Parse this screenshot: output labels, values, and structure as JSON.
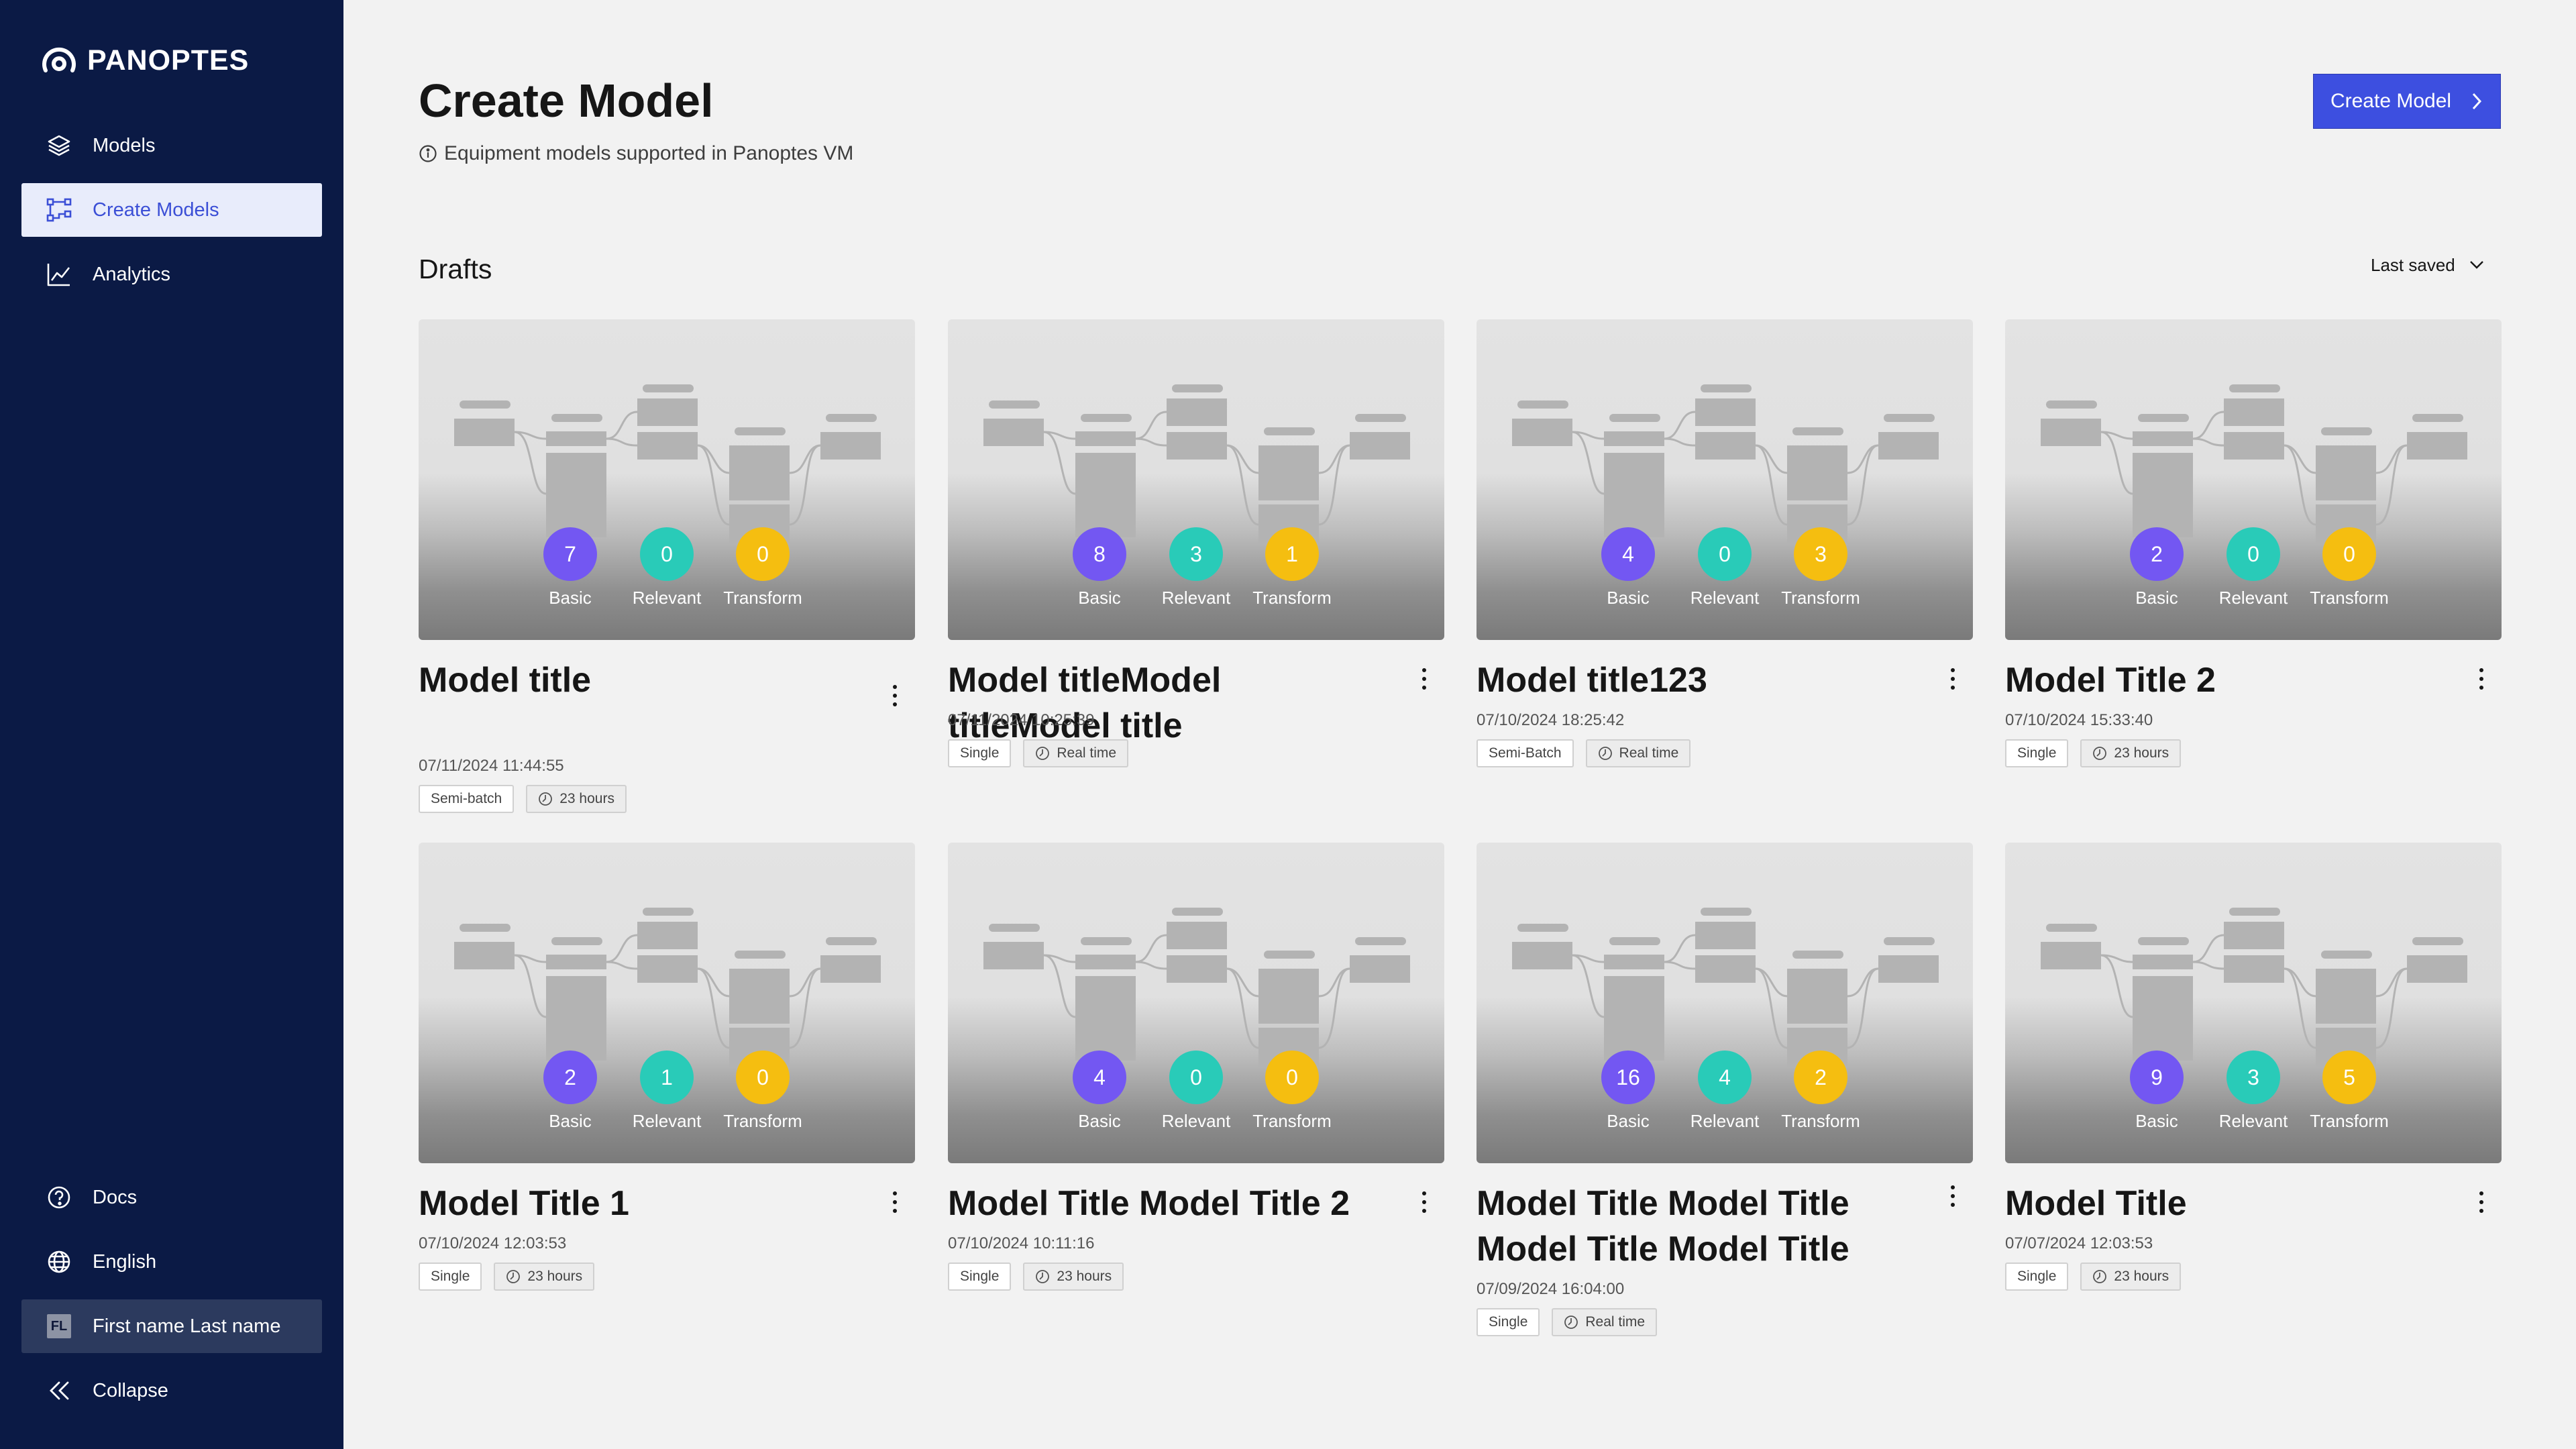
{
  "sidebar": {
    "brand": "PANOPTES",
    "nav": [
      {
        "label": "Models",
        "icon": "layers-icon"
      },
      {
        "label": "Create Models",
        "icon": "flow-icon",
        "active": true
      },
      {
        "label": "Analytics",
        "icon": "chart-line-icon"
      }
    ],
    "bottom": [
      {
        "label": "Docs",
        "icon": "help-circle-icon"
      },
      {
        "label": "English",
        "icon": "globe-icon"
      },
      {
        "label": "First name Last name",
        "initials": "FL"
      },
      {
        "label": "Collapse",
        "icon": "double-chevron-left-icon"
      }
    ]
  },
  "header": {
    "title": "Create Model",
    "subtitle": "Equipment models supported in Panoptes VM",
    "create_button": "Create Model"
  },
  "drafts": {
    "heading": "Drafts",
    "sort_label": "Last saved",
    "badge_labels": {
      "basic": "Basic",
      "relevant": "Relevant",
      "transform": "Transform"
    },
    "cards": [
      {
        "title": "Model title",
        "date": "07/11/2024 11:44:55",
        "type": "Semi-batch",
        "duration": "23 hours",
        "basic": 7,
        "relevant": 0,
        "transform": 0
      },
      {
        "title": "Model titleModel titleModel title",
        "date": "07/11/2024 10:25:39",
        "type": "Single",
        "duration": "Real time",
        "basic": 8,
        "relevant": 3,
        "transform": 1
      },
      {
        "title": "Model title123",
        "date": "07/10/2024 18:25:42",
        "type": "Semi-Batch",
        "duration": "Real time",
        "basic": 4,
        "relevant": 0,
        "transform": 3
      },
      {
        "title": "Model Title 2",
        "date": "07/10/2024 15:33:40",
        "type": "Single",
        "duration": "23 hours",
        "basic": 2,
        "relevant": 0,
        "transform": 0
      },
      {
        "title": "Model Title 1",
        "date": "07/10/2024 12:03:53",
        "type": "Single",
        "duration": "23 hours",
        "basic": 2,
        "relevant": 1,
        "transform": 0
      },
      {
        "title": "Model Title Model Title 2",
        "date": "07/10/2024 10:11:16",
        "type": "Single",
        "duration": "23 hours",
        "basic": 4,
        "relevant": 0,
        "transform": 0
      },
      {
        "title": "Model Title Model Title Model Title Model Title",
        "date": "07/09/2024 16:04:00",
        "type": "Single",
        "duration": "Real time",
        "basic": 16,
        "relevant": 4,
        "transform": 2
      },
      {
        "title": "Model Title",
        "date": "07/07/2024 12:03:53",
        "type": "Single",
        "duration": "23 hours",
        "basic": 9,
        "relevant": 3,
        "transform": 5
      }
    ]
  }
}
